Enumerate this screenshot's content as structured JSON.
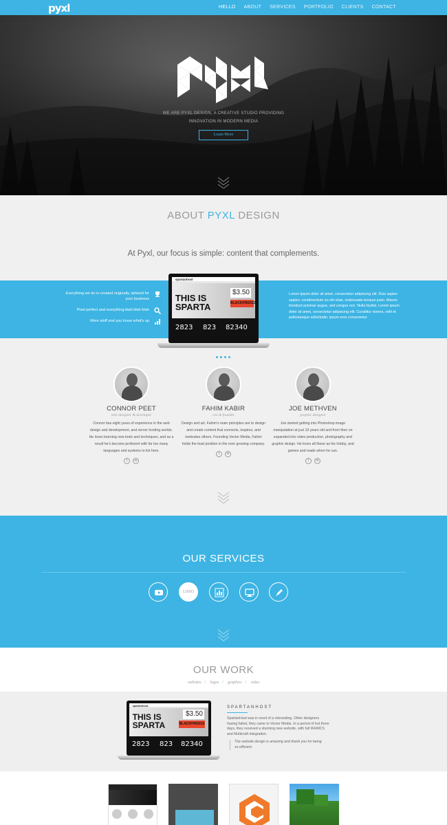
{
  "nav": {
    "logo": "pyxl",
    "items": [
      "HELLO",
      "ABOUT",
      "SERVICES",
      "PORTFOLIO",
      "CLIENTS",
      "CONTACT"
    ]
  },
  "hero": {
    "tagline_1": "WE ARE PYXL DESIGN, A CREATIVE STUDIO PROVIDING",
    "tagline_2": "INNOVATION IN MODERN MEDIA",
    "button": "Learn More"
  },
  "about": {
    "title_pre": "ABOUT ",
    "title_hl": "PYXL",
    "title_post": " DESIGN",
    "subtitle": "At Pyxl, our focus is simple: content that complements.",
    "features": [
      "Everything we do is created originally, tailored for your business",
      "Pixel perfect and everything blah blah blah",
      "More stuff and you know what's up"
    ],
    "lorem": "Lorem ipsum dolor sit amet, consectetur adipiscing elit. Duis sapien sapien, condimentum eu elit vitae, malesuada tempus justo. Mauris tincidunt pulvinar augue, sed congue orci. Nulla facilisi. Lorem ipsum dolor sit amet, consectetur adipiscing elit. Curabitur viverra, velit et pellentesque sollicitudin, ipsum eros consectetur"
  },
  "mockup": {
    "logo": "spartanhost",
    "headline_1": "THIS IS",
    "headline_2": "SPARTA",
    "price": "$3.50",
    "code": "BLACKFRI2013",
    "stats": [
      "2823",
      "823",
      "82340"
    ]
  },
  "team": [
    {
      "name": "CONNOR PEET",
      "role": "web designer & developer",
      "bio": "Connor has eight years of experience in the web design and development, and server hosting worlds. He loves learning new tools and techniques, and as a result he's become proficient with far too many languages and systems to list here."
    },
    {
      "name": "FAHIM KABIR",
      "role": "ceo & founder",
      "bio": "Design and art. Fahim's main principles are to design and create content that connects, inspires, and motivates others. Founding Vector Media, Fahim holds the lead position in the ever growing company."
    },
    {
      "name": "JOE METHVEN",
      "role": "graphic designer",
      "bio": "Joe started getting into Photoshop image manipulation at just 10 years old and from then on expanded into video production, photography and graphic design. He loves all these as his hobby, and games and reads when he can."
    }
  ],
  "services": {
    "title": "OUR SERVICES",
    "icons": [
      "youtube-icon",
      "logo",
      "chart-icon",
      "monitor-icon",
      "pencil-icon"
    ],
    "logo_label": "LOGO"
  },
  "work": {
    "title": "OUR WORK",
    "filters": [
      "websites",
      "logos",
      "graphics",
      "video"
    ],
    "project_title": "SPARTANHOST",
    "project_desc": "SpartanHost was in need of a rebranding. Other designers having failed, they came to Vector Media. In a period of but three days, they received a stunning new website, with full WHMCS and Multicraft integration.",
    "project_quote": "The website design is amazing and thank you for being so efficient."
  },
  "colors": {
    "accent": "#3db4e3",
    "dark": "#1b1b1b",
    "light": "#f0f0f0"
  }
}
